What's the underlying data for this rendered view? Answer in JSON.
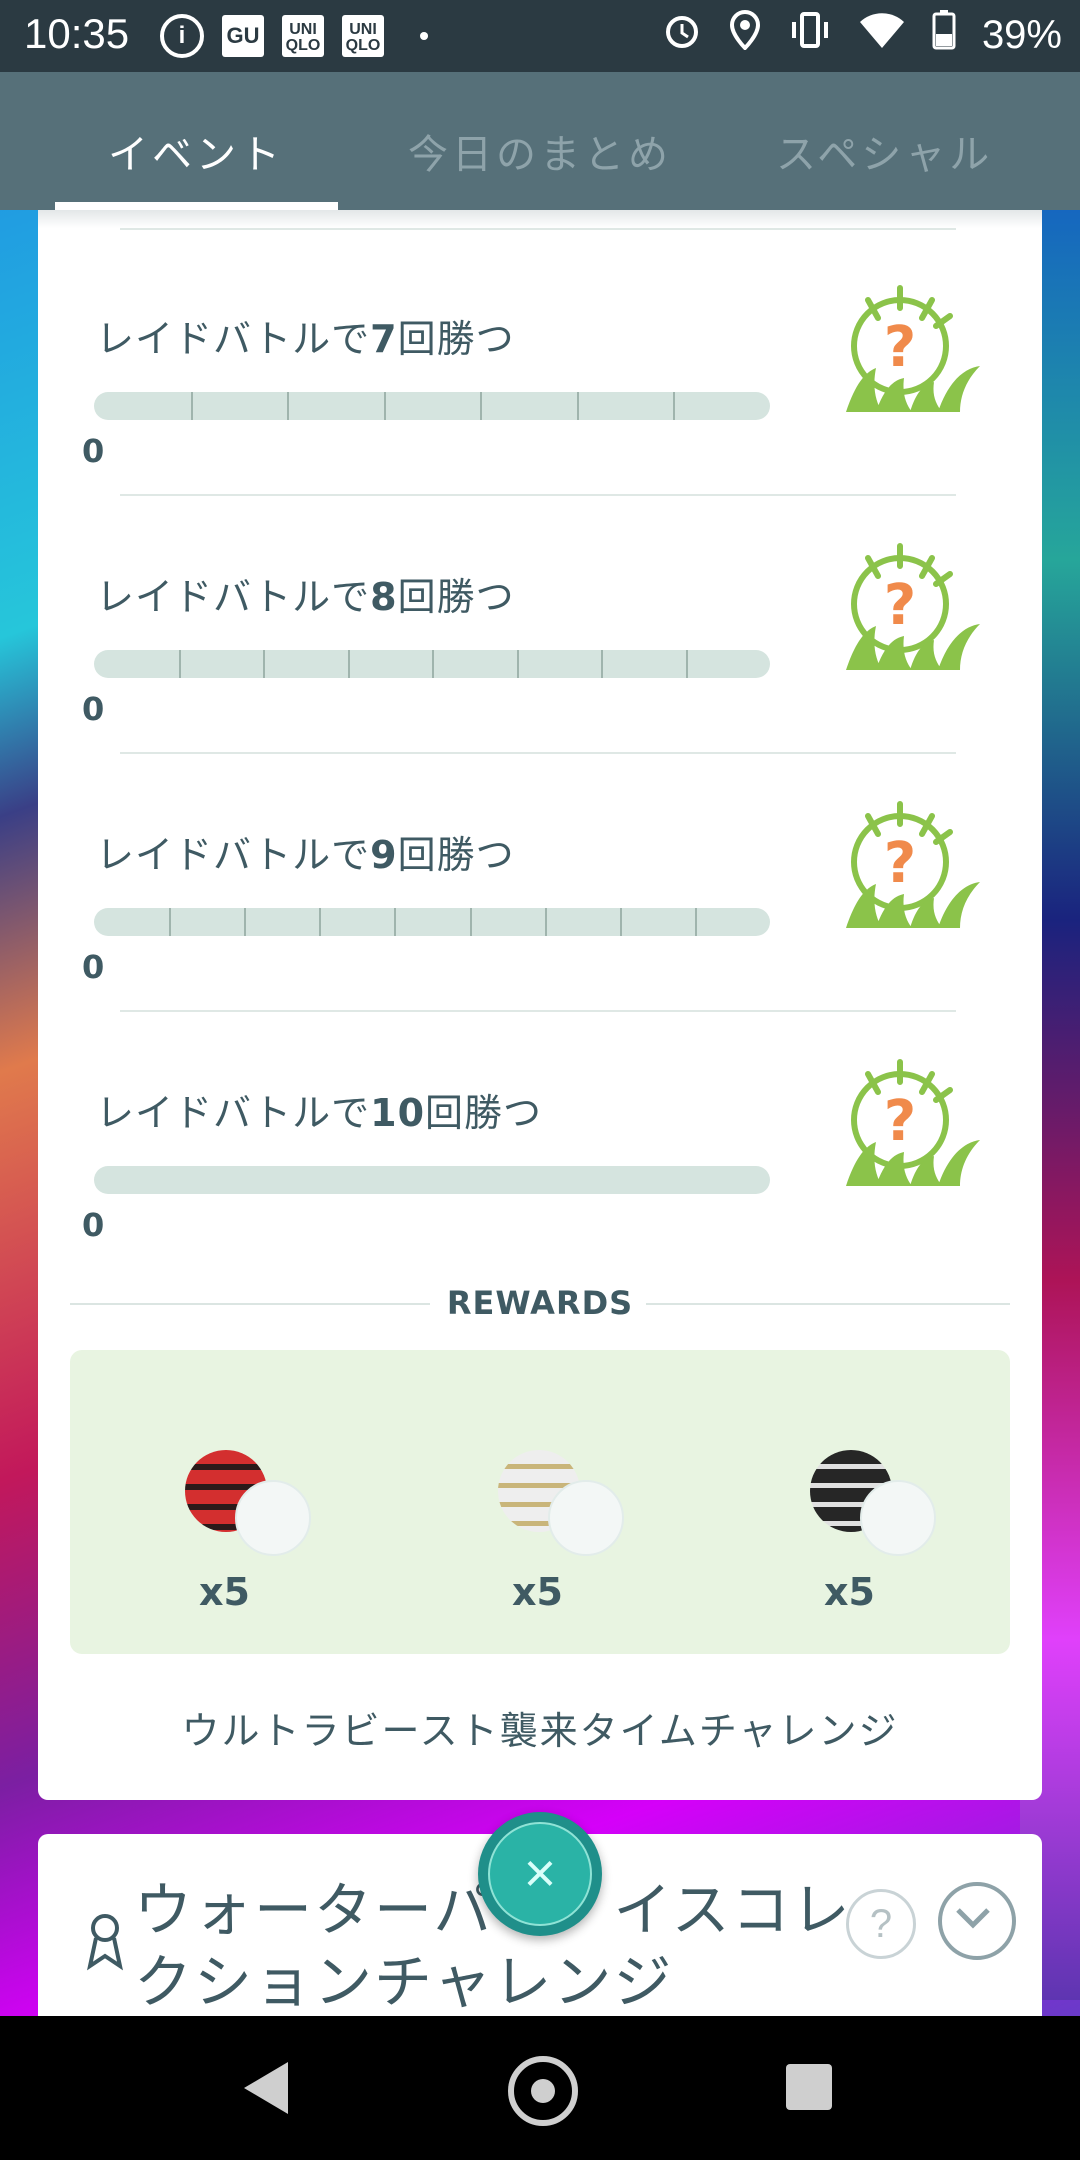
{
  "status_bar": {
    "time": "10:35",
    "left_icons": [
      "info-icon",
      "gu-app-icon",
      "uniqlo-app-icon",
      "uniqlo-app-icon",
      "dot-icon"
    ],
    "gu_label": "GU",
    "uniqlo_label": "UNI QLO",
    "right_icons": [
      "alarm-icon",
      "location-icon",
      "vibrate-icon",
      "wifi-icon",
      "battery-icon"
    ],
    "battery": "39%"
  },
  "tabs": [
    {
      "label": "イベント",
      "active": true
    },
    {
      "label": "今日のまとめ",
      "active": false
    },
    {
      "label": "スペシャル",
      "active": false
    }
  ],
  "tasks": [
    {
      "prefix": "レイドバトルで",
      "count": "7",
      "suffix": "回勝つ",
      "progress": "0",
      "segments": 7
    },
    {
      "prefix": "レイドバトルで",
      "count": "8",
      "suffix": "回勝つ",
      "progress": "0",
      "segments": 8
    },
    {
      "prefix": "レイドバトルで",
      "count": "9",
      "suffix": "回勝つ",
      "progress": "0",
      "segments": 9
    },
    {
      "prefix": "レイドバトルで",
      "count": "10",
      "suffix": "回勝つ",
      "progress": "0",
      "segments": 1
    }
  ],
  "task_reward_icon": "mystery-encounter-grass-icon",
  "task_reward_symbol": "?",
  "rewards": {
    "label": "REWARDS",
    "items": [
      {
        "icon": "repeat-ball-icon",
        "count": "x5",
        "color": "#c62828"
      },
      {
        "icon": "premier-ball-icon",
        "count": "x5",
        "color": "#e0e0e0"
      },
      {
        "icon": "dark-ball-icon",
        "count": "x5",
        "color": "#212121"
      }
    ]
  },
  "challenge_name": "ウルトラビースト襲来タイムチャレンジ",
  "next_card": {
    "title": "ウォーターパラダイスコレクションチャレンジ",
    "title_visible": "ウォーターパ　　イスコレ\nクションチャレンジ",
    "help_symbol": "?"
  },
  "fab_symbol": "×",
  "colors": {
    "tab_bar": "#567079",
    "status_bar": "#2b3a42",
    "text": "#3f5a63",
    "progress_bg": "#d5e4df",
    "rewards_bg": "#e8f4e1",
    "fab": "#2ab3a6"
  }
}
